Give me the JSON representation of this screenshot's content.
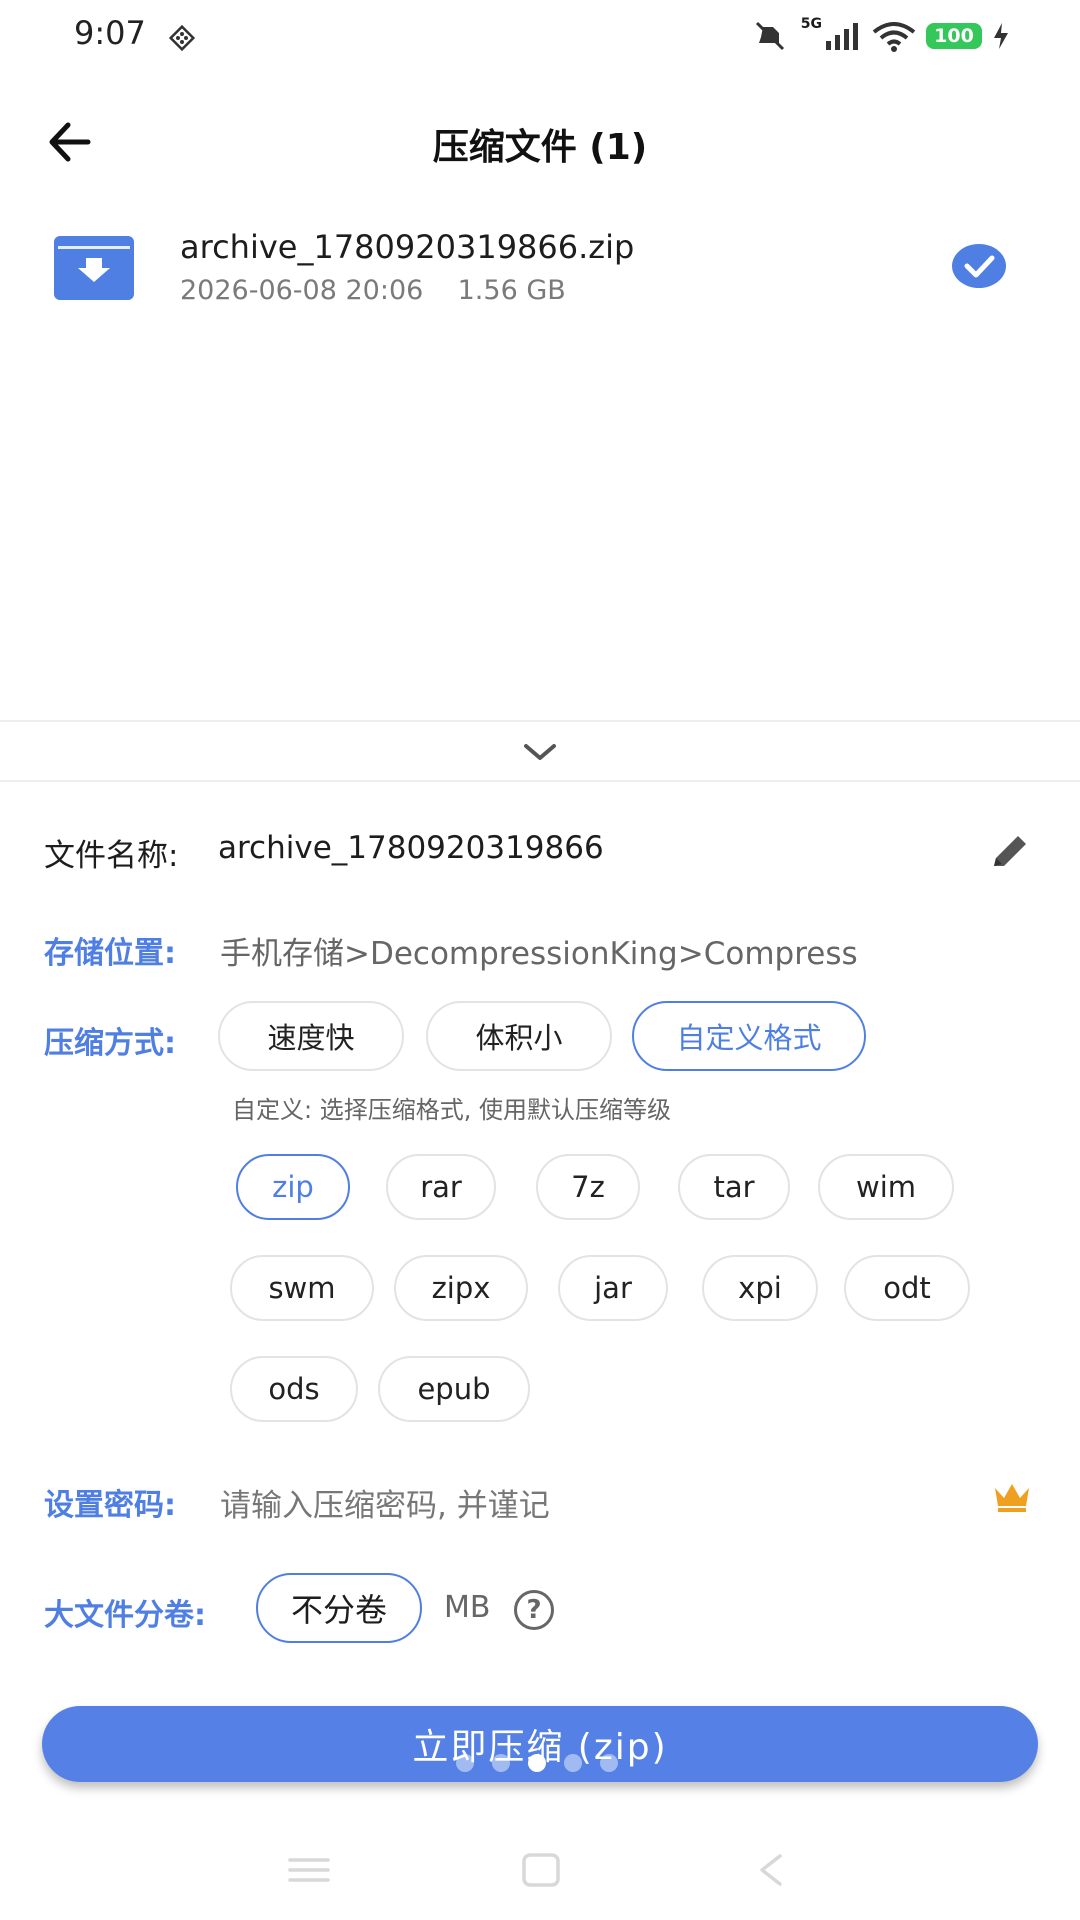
{
  "status_bar": {
    "time": "9:07",
    "network": "5G",
    "battery": "100",
    "icons": [
      "grid-icon",
      "mute-icon",
      "signal-icon",
      "wifi-icon",
      "battery-icon",
      "charging-icon"
    ]
  },
  "header": {
    "title": "压缩文件 (1)"
  },
  "file": {
    "name": "archive_1780920319866.zip",
    "meta": "2026-06-08 20:06    1.56 GB",
    "selected": true
  },
  "form": {
    "filename_label": "文件名称:",
    "filename_value": "archive_1780920319866",
    "location_label": "存储位置:",
    "location_value": "手机存储>DecompressionKing>Compress",
    "mode_label": "压缩方式:",
    "modes": [
      "速度快",
      "体积小",
      "自定义格式"
    ],
    "selected_mode": "自定义格式",
    "mode_hint": "自定义: 选择压缩格式, 使用默认压缩等级",
    "formats": [
      "zip",
      "rar",
      "7z",
      "tar",
      "wim",
      "swm",
      "zipx",
      "jar",
      "xpi",
      "odt",
      "ods",
      "epub"
    ],
    "selected_format": "zip",
    "password_label": "设置密码:",
    "password_placeholder": "请输入压缩密码, 并谨记",
    "volume_label": "大文件分卷:",
    "volume_value": "不分卷",
    "volume_unit": "MB",
    "help_glyph": "?"
  },
  "action": {
    "label": "立即压缩 (zip)"
  },
  "colors": {
    "accent": "#4f7fe3",
    "button": "#5581e6",
    "crown": "#f0a020"
  }
}
